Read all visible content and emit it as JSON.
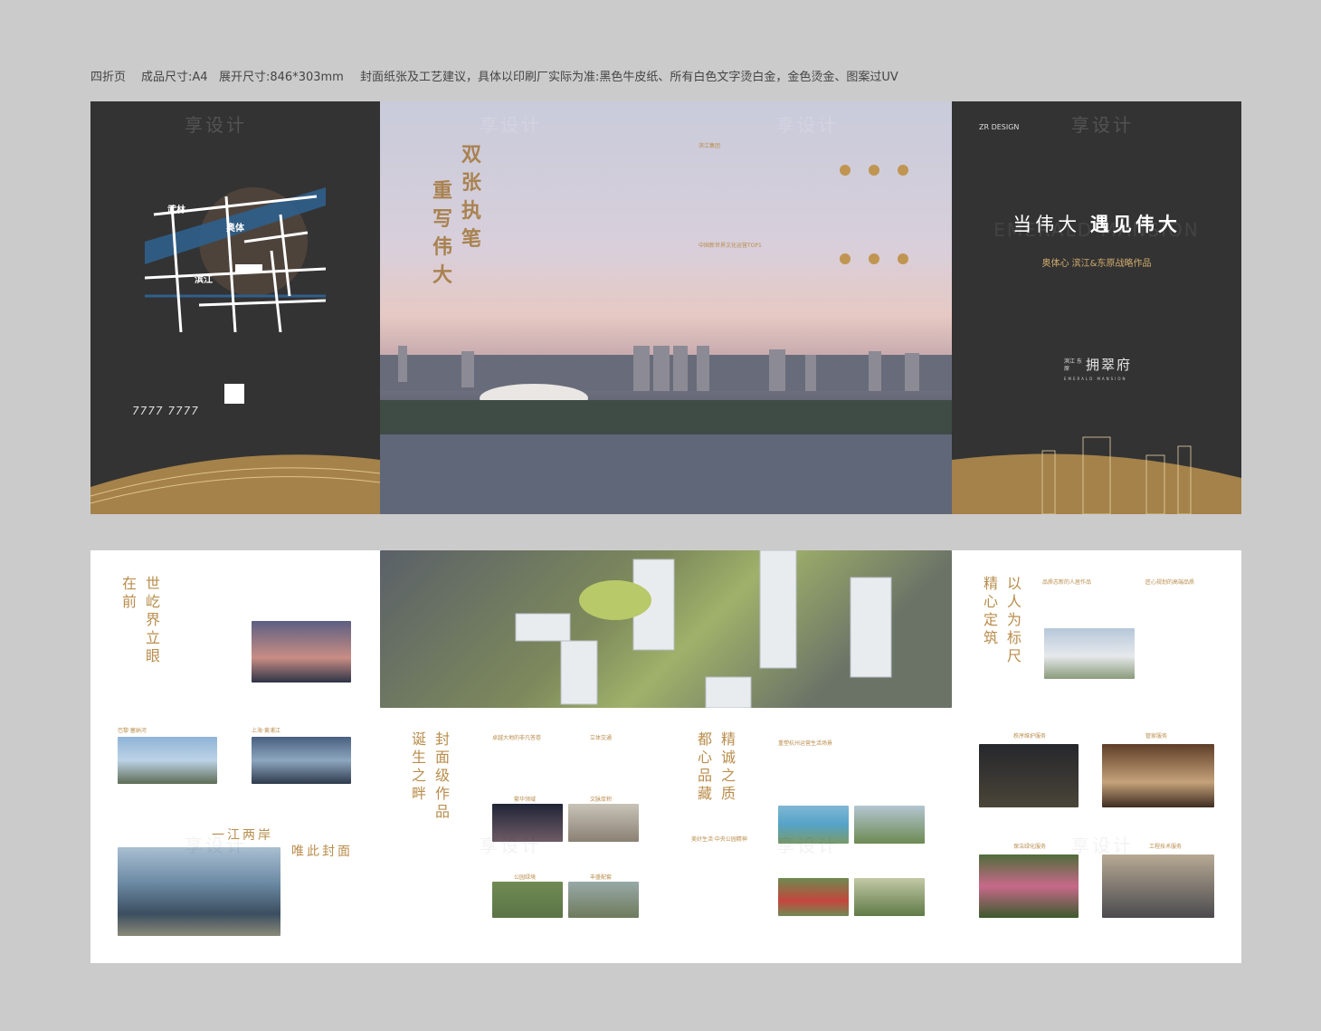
{
  "spec": {
    "fold": "四折页",
    "size": "成品尺寸:A4",
    "open_size": "展开尺寸:846*303mm",
    "note": "封面纸张及工艺建议，具体以印刷厂实际为准:黑色牛皮纸、所有白色文字烫白金，金色烫金、图案过UV"
  },
  "watermark": "享设计",
  "panel1": {
    "map_labels": [
      "武林",
      "奥体",
      "滨江"
    ],
    "phone": "7777 7777"
  },
  "panel2": {
    "calligraphy_col1": "双张执笔",
    "calligraphy_col2": "重写伟大"
  },
  "panel3": {
    "heading1": "滨江集团",
    "heading2": "中国新世界文化运营TOP1"
  },
  "cover": {
    "logo": "ZR DESIGN",
    "title_left": "当伟大",
    "title_right": "遇见伟大",
    "subtitle": "奥体心 滨江&东原战略作品",
    "ghost_en": "EMERALD MANSION",
    "brand": "拥翠府",
    "brand_left": "滨江 东原",
    "brand_en": "EMERALD MANSION"
  },
  "bottom": {
    "p1_title": "世屹界立眼在前",
    "p1_cap1": "巴黎·塞纳河",
    "p1_cap2": "上海·黄浦江",
    "p1_head": "一江两岸",
    "p1_head2": "唯此封面",
    "p2_title": "封面级作品诞生之畔",
    "p2_cap1": "卓越大地的非凡答卷",
    "p2_cap2": "立体交通",
    "p2_cap3": "繁华领域",
    "p2_cap4": "文脉厚积",
    "p2_cap5": "公园绿境",
    "p2_cap6": "丰盛配套",
    "p3_title": "精诚之质都心品藏",
    "p3_cap1": "重塑杭州运营生活场景",
    "p3_cap2": "美好生活·中央公园精神",
    "p4_title": "以人为标尺精心定筑",
    "p4_cap1": "品质志新的人居作品",
    "p4_cap2": "匠心规划的高端品质",
    "p4_cap3": "秩序维护服务",
    "p4_cap4": "管家服务",
    "p4_cap5": "保洁绿化服务",
    "p4_cap6": "工程技术服务"
  }
}
